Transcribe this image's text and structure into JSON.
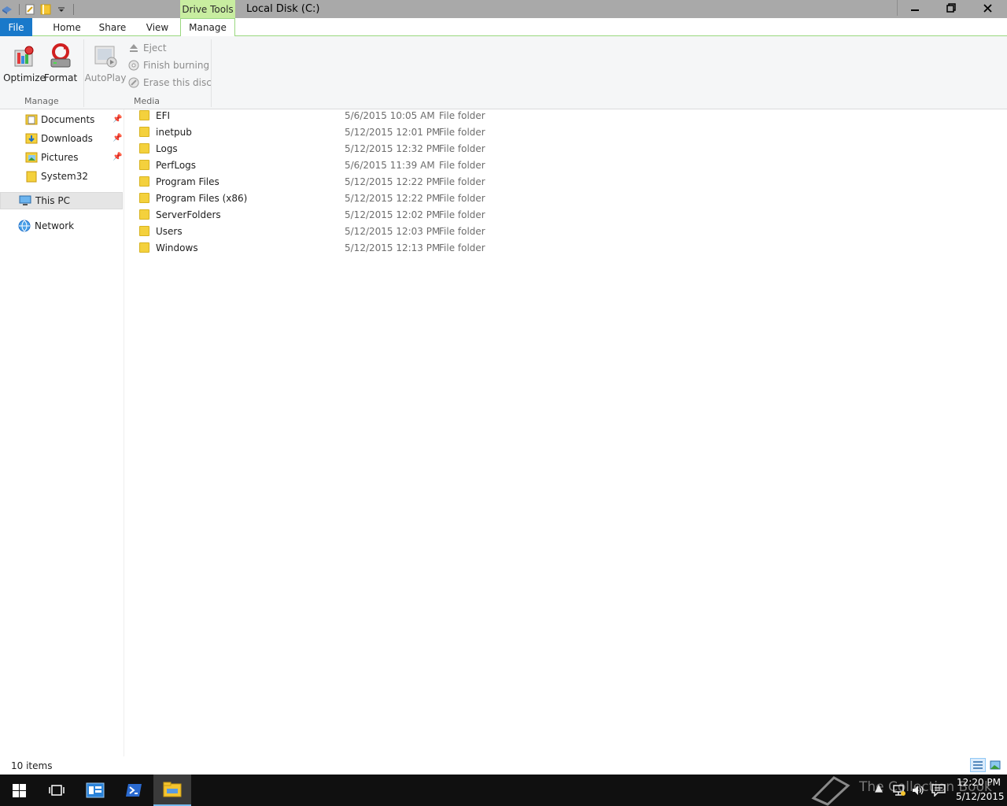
{
  "titlebar": {
    "contextual_tab": "Drive Tools",
    "window_title": "Local Disk (C:)"
  },
  "ribbon_tabs": {
    "file": "File",
    "home": "Home",
    "share": "Share",
    "view": "View",
    "manage": "Manage"
  },
  "ribbon": {
    "optimize": "Optimize",
    "format": "Format",
    "autoplay": "AutoPlay",
    "eject": "Eject",
    "finish_burning": "Finish burning",
    "erase_disc": "Erase this disc",
    "group_manage": "Manage",
    "group_media": "Media"
  },
  "nav": {
    "documents": "Documents",
    "downloads": "Downloads",
    "pictures": "Pictures",
    "system32": "System32",
    "this_pc": "This PC",
    "network": "Network"
  },
  "files": [
    {
      "name": "EFI",
      "date": "5/6/2015 10:05 AM",
      "type": "File folder"
    },
    {
      "name": "inetpub",
      "date": "5/12/2015 12:01 PM",
      "type": "File folder"
    },
    {
      "name": "Logs",
      "date": "5/12/2015 12:32 PM",
      "type": "File folder"
    },
    {
      "name": "PerfLogs",
      "date": "5/6/2015 11:39 AM",
      "type": "File folder"
    },
    {
      "name": "Program Files",
      "date": "5/12/2015 12:22 PM",
      "type": "File folder"
    },
    {
      "name": "Program Files (x86)",
      "date": "5/12/2015 12:22 PM",
      "type": "File folder"
    },
    {
      "name": "ServerFolders",
      "date": "5/12/2015 12:02 PM",
      "type": "File folder"
    },
    {
      "name": "Users",
      "date": "5/12/2015 12:03 PM",
      "type": "File folder"
    },
    {
      "name": "Windows",
      "date": "5/12/2015 12:13 PM",
      "type": "File folder"
    }
  ],
  "status": {
    "item_count": "10 items"
  },
  "taskbar": {
    "watermark": "The Collection Book",
    "time": "12:20 PM",
    "date": "5/12/2015"
  },
  "colors": {
    "accent": "#1979ca",
    "contextual_tab": "#c8eda0",
    "folder": "#f4d13d"
  }
}
